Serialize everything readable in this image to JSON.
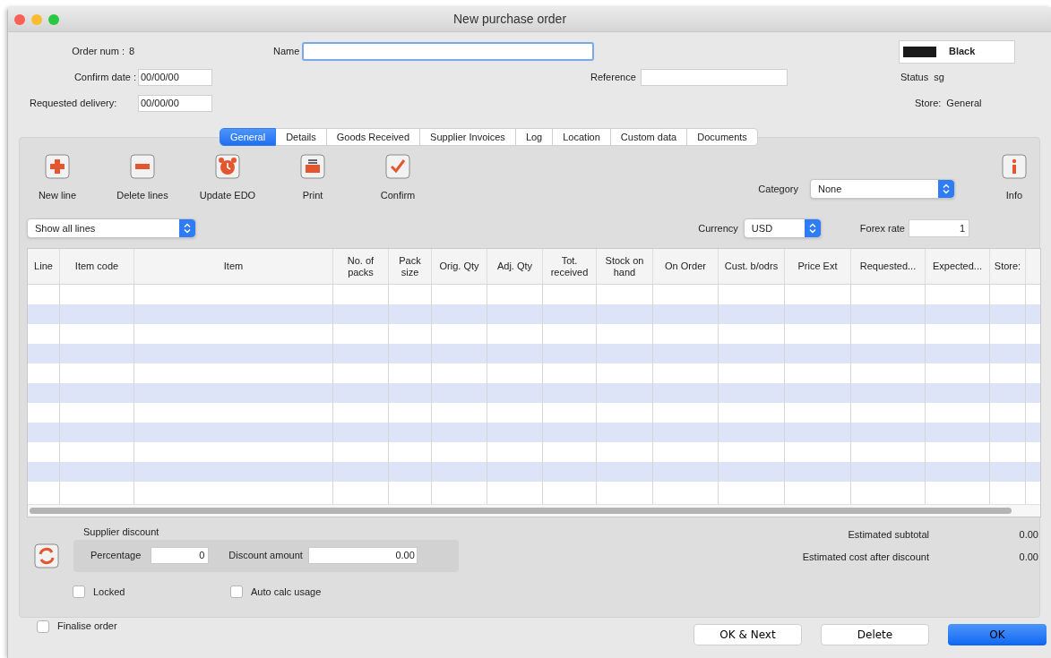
{
  "window": {
    "title": "New purchase order"
  },
  "header": {
    "order_num_label": "Order num :",
    "order_num": "8",
    "confirm_date_label": "Confirm date :",
    "confirm_date": "00/00/00",
    "requested_delivery_label": "Requested delivery:",
    "requested_delivery": "00/00/00",
    "name_label": "Name",
    "reference_label": "Reference",
    "color_label": "Black",
    "status_label": "Status",
    "status": "sg",
    "store_label": "Store:",
    "store": "General"
  },
  "tabs": [
    {
      "label": "General",
      "selected": true
    },
    {
      "label": "Details",
      "selected": false
    },
    {
      "label": "Goods Received",
      "selected": false
    },
    {
      "label": "Supplier Invoices",
      "selected": false
    },
    {
      "label": "Log",
      "selected": false
    },
    {
      "label": "Location",
      "selected": false
    },
    {
      "label": "Custom data",
      "selected": false
    },
    {
      "label": "Documents",
      "selected": false
    }
  ],
  "toolbar": [
    {
      "label": "New line",
      "kind": "add"
    },
    {
      "label": "Delete lines",
      "kind": "remove"
    },
    {
      "label": "Update EDO",
      "kind": "alarm"
    },
    {
      "label": "Print",
      "kind": "print"
    },
    {
      "label": "Confirm",
      "kind": "confirm"
    }
  ],
  "info_button": {
    "label": "Info"
  },
  "category": {
    "label": "Category",
    "value": "None"
  },
  "line_filter": {
    "value": "Show all lines"
  },
  "currency": {
    "label": "Currency",
    "value": "USD"
  },
  "forex": {
    "label": "Forex rate",
    "value": "1"
  },
  "table": {
    "columns": [
      "Line",
      "Item code",
      "Item",
      "No. of packs",
      "Pack size",
      "Orig. Qty",
      "Adj. Qty",
      "Tot. received",
      "Stock on hand",
      "On Order",
      "Cust. b/odrs",
      "Price Ext",
      "Requested...",
      "Expected...",
      "Store:"
    ]
  },
  "discount": {
    "title": "Supplier discount",
    "percentage_label": "Percentage",
    "percentage": "0",
    "amount_label": "Discount amount",
    "amount": "0.00"
  },
  "options": [
    {
      "label": "Locked",
      "checked": false
    },
    {
      "label": "Auto calc usage",
      "checked": false
    }
  ],
  "totals": [
    {
      "label": "Estimated subtotal",
      "value": "0.00"
    },
    {
      "label": "Estimated cost after discount",
      "value": "0.00"
    }
  ],
  "finalise": {
    "label": "Finalise order",
    "checked": false
  },
  "buttons": [
    {
      "label": "OK & Next",
      "kind": "default"
    },
    {
      "label": "Delete",
      "kind": "default"
    },
    {
      "label": "OK",
      "kind": "primary"
    }
  ]
}
